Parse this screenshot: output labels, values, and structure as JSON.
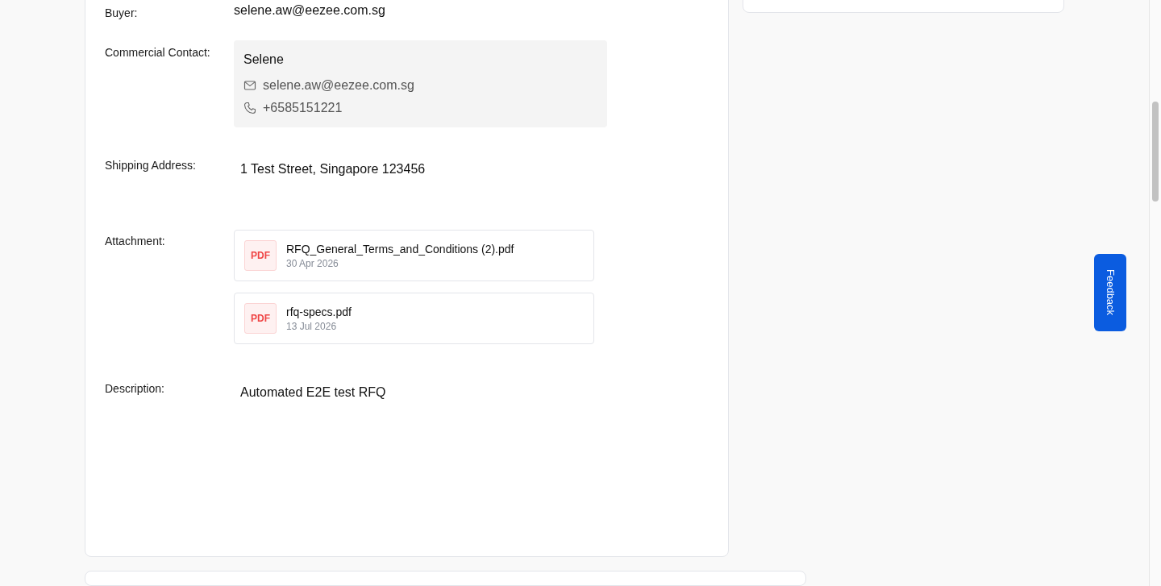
{
  "details": [
    {
      "kind": "text",
      "label": "Buyer:",
      "value": "selene.aw@eezee.com.sg"
    },
    {
      "kind": "contact",
      "label": "Commercial Contact:",
      "contact": {
        "name": "Selene",
        "email": "selene.aw@eezee.com.sg",
        "phone": "+6585151221"
      }
    },
    {
      "kind": "block",
      "label": "Shipping Address:",
      "value": "1 Test Street, Singapore 123456"
    },
    {
      "kind": "attachments",
      "label": "Attachment:",
      "files": [
        {
          "type": "PDF",
          "name": "RFQ_General_Terms_and_Conditions (2).pdf",
          "date": "30 Apr 2026"
        },
        {
          "type": "PDF",
          "name": "rfq-specs.pdf",
          "date": "13 Jul 2026"
        }
      ]
    },
    {
      "kind": "block",
      "label": "Description:",
      "value": "Automated E2E test RFQ"
    }
  ],
  "feedback_button": {
    "label": "Feedback"
  }
}
